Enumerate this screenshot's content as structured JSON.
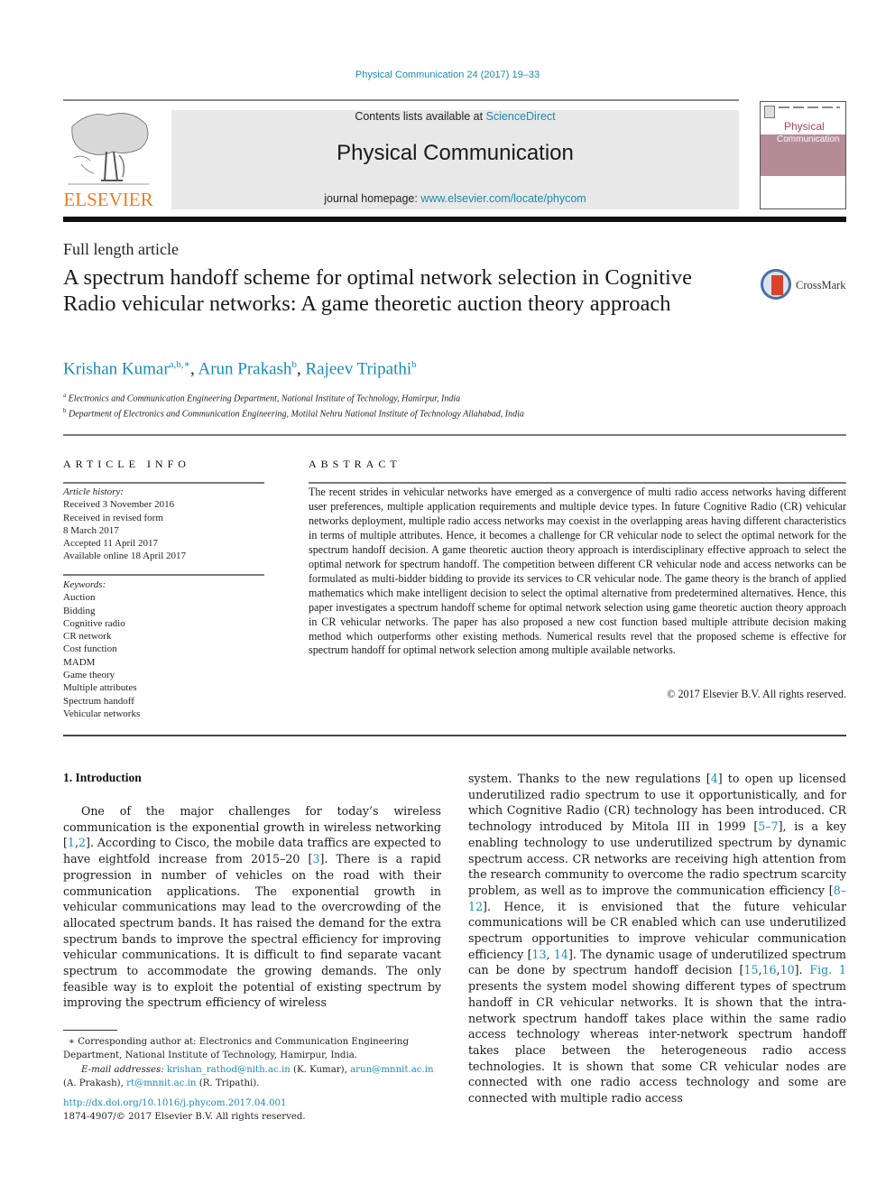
{
  "journal_ref": "Physical Communication 24 (2017) 19–33",
  "header": {
    "publisher_logo_text": "ELSEVIER",
    "contents_prefix": "Contents lists available at ",
    "contents_link": "ScienceDirect",
    "journal_title": "Physical Communication",
    "homepage_prefix": "journal homepage: ",
    "homepage_link": "www.elsevier.com/locate/phycom",
    "cover_title_line1": "Physical",
    "cover_title_line2": "Communication"
  },
  "article": {
    "type": "Full length article",
    "title": "A spectrum handoff scheme for optimal network selection in Cognitive Radio vehicular networks: A game theoretic auction theory approach",
    "crossmark_label": "CrossMark",
    "authors": [
      {
        "name": "Krishan Kumar",
        "sup": "a,b,∗",
        "sep": ", "
      },
      {
        "name": "Arun Prakash",
        "sup": "b",
        "sep": ", "
      },
      {
        "name": "Rajeev Tripathi",
        "sup": "b",
        "sep": ""
      }
    ],
    "affiliations": [
      {
        "mark": "a",
        "text": "Electronics and Communication Engineering Department, National Institute of Technology, Hamirpur, India"
      },
      {
        "mark": "b",
        "text": "Department of Electronics and Communication Engineering, Motilal Nehru National Institute of Technology Allahabad, India"
      }
    ]
  },
  "article_info": {
    "heading": "ARTICLE INFO",
    "history_label": "Article history:",
    "history": [
      "Received 3 November 2016",
      "Received in revised form",
      "8 March 2017",
      "Accepted 11 April 2017",
      "Available online 18 April 2017"
    ],
    "keywords_label": "Keywords:",
    "keywords": [
      "Auction",
      "Bidding",
      "Cognitive radio",
      "CR network",
      "Cost function",
      "MADM",
      "Game theory",
      "Multiple attributes",
      "Spectrum handoff",
      "Vehicular networks"
    ]
  },
  "abstract": {
    "heading": "ABSTRACT",
    "text": "The recent strides in vehicular networks have emerged as a convergence of multi radio access networks having different user preferences, multiple application requirements and multiple device types. In future Cognitive Radio (CR) vehicular networks deployment, multiple radio access networks may coexist in the overlapping areas having different characteristics in terms of multiple attributes. Hence, it becomes a challenge for CR vehicular node to select the optimal network for the spectrum handoff decision. A game theoretic auction theory approach is interdisciplinary effective approach to select the optimal network for spectrum handoff. The competition between different CR vehicular node and access networks can be formulated as multi-bidder bidding to provide its services to CR vehicular node. The game theory is the branch of applied mathematics which make intelligent decision to select the optimal alternative from predetermined alternatives. Hence, this paper investigates a spectrum handoff scheme for optimal network selection using game theoretic auction theory approach in CR vehicular networks. The paper has also proposed a new cost function based multiple attribute decision making method which outperforms other existing methods. Numerical results revel that the proposed scheme is effective for spectrum handoff for optimal network selection among multiple available networks.",
    "copyright": "© 2017 Elsevier B.V. All rights reserved."
  },
  "intro": {
    "heading": "1.  Introduction",
    "left": [
      {
        "t": "One of the major challenges for today’s wireless communication is the exponential growth in wireless networking ["
      },
      {
        "ref": "1"
      },
      {
        "t": ","
      },
      {
        "ref": "2"
      },
      {
        "t": "]. According to Cisco, the mobile data traffics are expected to have eightfold increase from 2015–20 ["
      },
      {
        "ref": "3"
      },
      {
        "t": "]. There is a rapid progression in number of vehicles on the road with their communication applications. The exponential growth in vehicular communications may lead to the overcrowding of the allocated spectrum bands. It has raised the demand for the extra spectrum bands to improve the spectral efficiency for improving vehicular communications. It is difficult to find separate vacant spectrum to accommodate the growing demands. The only feasible way is to exploit the potential of existing spectrum by improving the spectrum efficiency of wireless"
      }
    ],
    "right": [
      {
        "t": "system. Thanks to the new regulations ["
      },
      {
        "ref": "4"
      },
      {
        "t": "] to open up licensed underutilized radio spectrum to use it opportunistically, and for which Cognitive Radio (CR) technology has been introduced. CR technology introduced by Mitola III in 1999 ["
      },
      {
        "ref": "5–7"
      },
      {
        "t": "], is a key enabling technology to use underutilized spectrum by dynamic spectrum access. CR networks are receiving high attention from the research community to overcome the radio spectrum scarcity problem, as well as to improve the communication efficiency ["
      },
      {
        "ref": "8–12"
      },
      {
        "t": "]. Hence, it is envisioned that the future vehicular communications will be CR enabled which can use underutilized spectrum opportunities to improve vehicular communication efficiency ["
      },
      {
        "ref": "13"
      },
      {
        "t": ", "
      },
      {
        "ref": "14"
      },
      {
        "t": "]. The dynamic usage of underutilized spectrum can be done by spectrum handoff decision ["
      },
      {
        "ref": "15"
      },
      {
        "t": ","
      },
      {
        "ref": "16"
      },
      {
        "t": ","
      },
      {
        "ref": "10"
      },
      {
        "t": "]. "
      },
      {
        "ref": "Fig. 1"
      },
      {
        "t": " presents the system model showing different types of spectrum handoff in CR vehicular networks. It is shown that the intra-network spectrum handoff takes place within the same radio access technology whereas inter-network spectrum handoff takes place between the heterogeneous radio access technologies. It is shown that some CR vehicular nodes are connected with one radio access technology and some are connected with multiple radio access"
      }
    ]
  },
  "footnote": {
    "star": "∗",
    "corresponding": "Corresponding author at: Electronics and Communication Engineering Department, National Institute of Technology, Hamirpur, India.",
    "email_label": "E-mail addresses:",
    "emails": [
      {
        "addr": "krishan_rathod@nith.ac.in",
        "who": " (K. Kumar), "
      },
      {
        "addr": "arun@mnnit.ac.in",
        "who": " (A. Prakash), "
      },
      {
        "addr": "rt@mnnit.ac.in",
        "who": " (R. Tripathi)."
      }
    ],
    "doi": "http://dx.doi.org/10.1016/j.phycom.2017.04.001",
    "issn_copyright": "1874-4907/© 2017 Elsevier B.V. All rights reserved."
  },
  "colors": {
    "link": "#1a8cb4",
    "elsevier_orange": "#f07c21",
    "header_gray": "#e8e8e8"
  }
}
